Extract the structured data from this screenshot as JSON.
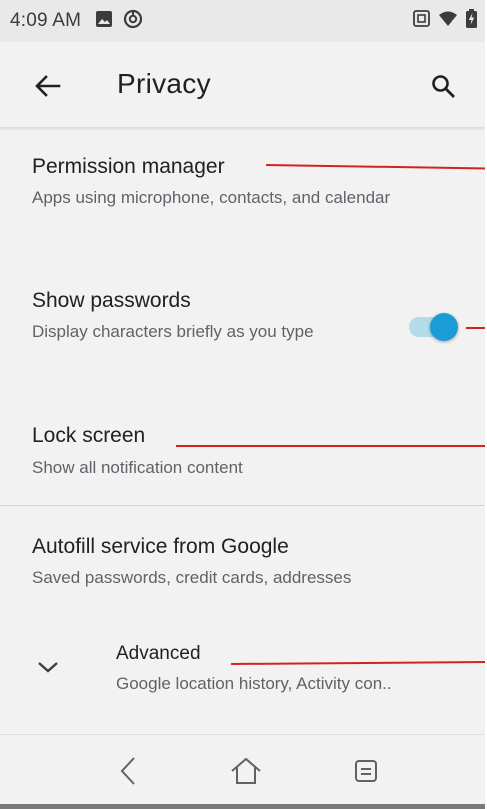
{
  "status_bar": {
    "time": "4:09 AM",
    "icons": [
      "gallery-icon",
      "sync-icon",
      "nfc-icon",
      "wifi-icon",
      "battery-charging-icon"
    ]
  },
  "app_bar": {
    "title": "Privacy",
    "back_icon": "arrow-back-icon",
    "search_icon": "search-icon"
  },
  "preferences": [
    {
      "title": "Permission manager",
      "summary": "Apps using microphone, contacts, and calendar"
    },
    {
      "title": "Show passwords",
      "summary": "Display characters briefly as you type",
      "toggle_on": true
    },
    {
      "title": "Lock screen",
      "summary": "Show all notification content"
    },
    {
      "title": "Autofill service from Google",
      "summary": "Saved passwords, credit cards, addresses"
    }
  ],
  "advanced": {
    "title": "Advanced",
    "summary": "Google location history, Activity con..",
    "icon": "chevron-down-icon"
  },
  "nav_bar": {
    "icons": [
      "nav-back-icon",
      "nav-home-icon",
      "nav-recents-icon"
    ]
  },
  "colors": {
    "background": "#f2f2f2",
    "status_bar": "#e9e9e9",
    "toggle_thumb": "#1a9dd6",
    "toggle_track": "#b2dcea",
    "annotation_line": "#d42222"
  }
}
